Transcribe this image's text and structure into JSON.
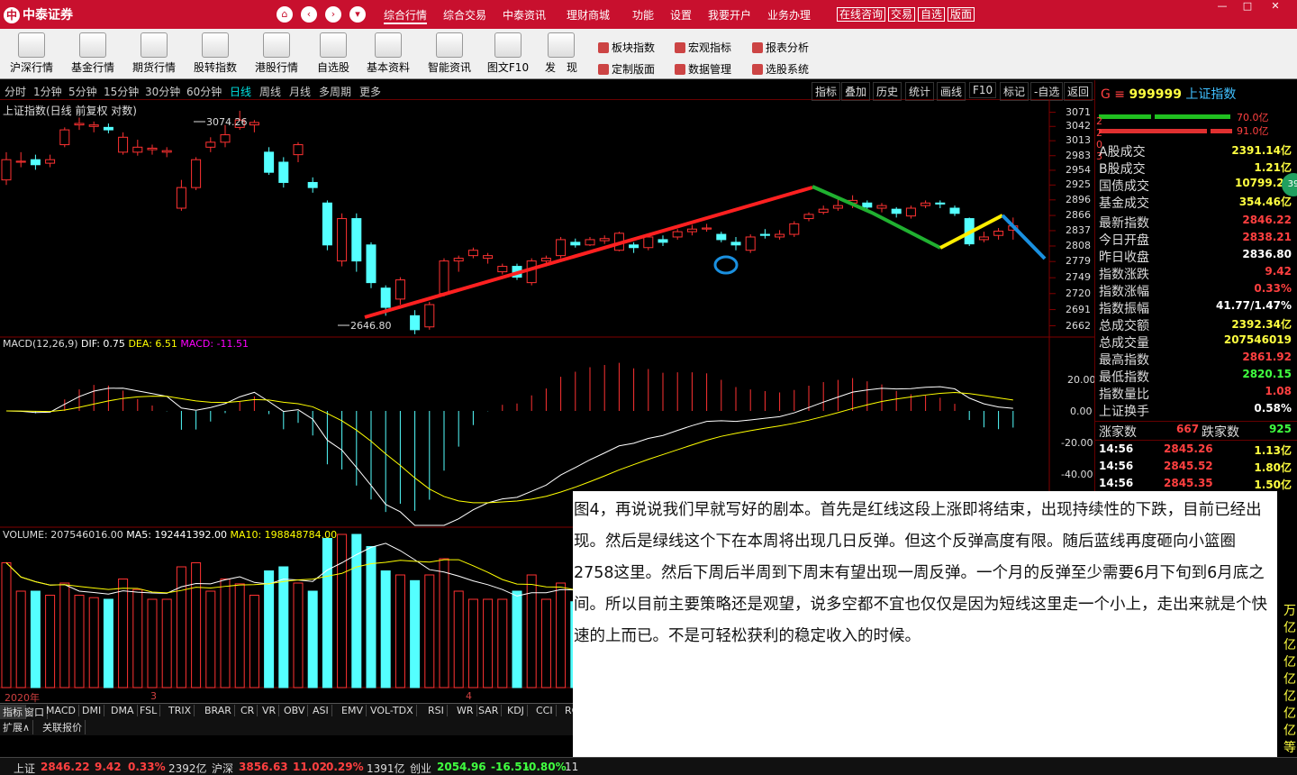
{
  "app": {
    "logo_text": "中泰证券",
    "logo_mark": "中"
  },
  "nav": {
    "home_icon": "⌂",
    "back_icon": "‹",
    "forward_icon": "›",
    "down_icon": "▾"
  },
  "menu": [
    "综合行情",
    "综合交易",
    "中泰资讯",
    "理财商城",
    "功能",
    "设置",
    "我要开户",
    "业务办理"
  ],
  "topbuttons": [
    "在线咨询",
    "交易",
    "自选",
    "版面"
  ],
  "window": {
    "min": "—",
    "max": "□",
    "close": "✕"
  },
  "toolbar": [
    "沪深行情",
    "基金行情",
    "期货行情",
    "股转指数",
    "港股行情",
    "自选股",
    "基本资料",
    "智能资讯",
    "图文F10",
    "发　现"
  ],
  "sidemenu": [
    "板块指数",
    "宏观指标",
    "报表分析",
    "定制版面",
    "数据管理",
    "选股系统"
  ],
  "timeframes": [
    "分时",
    "1分钟",
    "5分钟",
    "15分钟",
    "30分钟",
    "60分钟",
    "日线",
    "周线",
    "月线",
    "多周期",
    "更多"
  ],
  "charttools": [
    "指标",
    "叠加",
    "历史",
    "统计",
    "画线",
    "F10",
    "标记",
    "-自选",
    "返回"
  ],
  "main_chart": {
    "title": "上证指数(日线 前复权 对数)",
    "high_label": "3074.26",
    "low_label": "2646.80",
    "y_ticks": [
      "3071",
      "3042",
      "3013",
      "2983",
      "2954",
      "2925",
      "2896",
      "2866",
      "2837",
      "2808",
      "2779",
      "2749",
      "2720",
      "2691",
      "2662"
    ]
  },
  "macd": {
    "label": "MACD(12,26,9)",
    "dif": "DIF: 0.75",
    "dea": "DEA: 6.51",
    "macd": "MACD: -11.51",
    "y_ticks": [
      "20.00",
      "0.00",
      "-20.00",
      "-40.00"
    ]
  },
  "volume": {
    "label": "VOLUME: 207546016.00",
    "ma5": "MA5: 192441392.00",
    "ma10": "MA10: 198848784.00"
  },
  "x_labels": [
    "2020年",
    "3",
    "4"
  ],
  "indicator_tabs": [
    "指标",
    "窗口",
    "MACD",
    "DMI",
    "DMA",
    "FSL",
    "TRIX",
    "BRAR",
    "CR",
    "VR",
    "OBV",
    "ASI",
    "EMV",
    "VOL-TDX",
    "RSI",
    "WR",
    "SAR",
    "KDJ",
    "CCI",
    "RO"
  ],
  "extra_tabs": [
    "扩展∧",
    "关联报价"
  ],
  "right_panel": {
    "code": "999999",
    "name": "上证指数",
    "prefix": "G ≡",
    "bar_values": [
      "70.0亿",
      "91.0亿"
    ],
    "side_labels": [
      "2",
      "2",
      "0",
      "3"
    ],
    "turnover": [
      {
        "k": "A股成交",
        "v": "2391.14亿"
      },
      {
        "k": "B股成交",
        "v": "1.21亿"
      },
      {
        "k": "国债成交",
        "v": "10799.24"
      },
      {
        "k": "基金成交",
        "v": "354.46亿"
      }
    ],
    "stats": [
      {
        "k": "最新指数",
        "v": "2846.22",
        "c": "#ff4040"
      },
      {
        "k": "今日开盘",
        "v": "2838.21",
        "c": "#ff4040"
      },
      {
        "k": "昨日收盘",
        "v": "2836.80",
        "c": "#ffffff"
      },
      {
        "k": "指数涨跌",
        "v": "9.42",
        "c": "#ff4040"
      },
      {
        "k": "指数涨幅",
        "v": "0.33%",
        "c": "#ff4040"
      },
      {
        "k": "指数振幅",
        "v": "41.77/1.47%",
        "c": "#ffffff"
      },
      {
        "k": "总成交额",
        "v": "2392.34亿",
        "c": "#ffff40"
      },
      {
        "k": "总成交量",
        "v": "207546019",
        "c": "#ffff40"
      },
      {
        "k": "最高指数",
        "v": "2861.92",
        "c": "#ff4040"
      },
      {
        "k": "最低指数",
        "v": "2820.15",
        "c": "#40ff40"
      },
      {
        "k": "指数量比",
        "v": "1.08",
        "c": "#ff4040"
      },
      {
        "k": "上证换手",
        "v": "0.58%",
        "c": "#ffffff"
      }
    ],
    "updown": {
      "up_label": "涨家数",
      "up": "667",
      "down_label": "跌家数",
      "down": "925"
    },
    "ticks": [
      {
        "t": "14:56",
        "p": "2845.26",
        "v": "1.13亿"
      },
      {
        "t": "14:56",
        "p": "2845.52",
        "v": "1.80亿"
      },
      {
        "t": "14:56",
        "p": "2845.35",
        "v": "1.50亿"
      }
    ],
    "badge": "39",
    "partial_right": [
      "万",
      "亿",
      "亿",
      "亿",
      "亿",
      "亿",
      "亿",
      "亿",
      "等"
    ]
  },
  "note": "图4，再说说我们早就写好的剧本。首先是红线这段上涨即将结束，出现持续性的下跌，目前已经出现。然后是绿线这个下在本周将出现几日反弹。但这个反弹高度有限。随后蓝线再度砸向小篮圈2758这里。然后下周后半周到下周末有望出现一周反弹。一个月的反弹至少需要6月下旬到6月底之间。所以目前主要策略还是观望，说多空都不宜也仅仅是因为短线这里走一个小上，走出来就是个快速的上而已。不是可轻松获利的稳定收入的时候。",
  "status": [
    {
      "name": "上证",
      "price": "2846.22",
      "chg": "9.42",
      "pct": "0.33%",
      "amt": "2392亿"
    },
    {
      "name": "沪深",
      "price": "3856.63",
      "chg": "11.02",
      "pct": "0.29%",
      "amt": "1391亿"
    },
    {
      "name": "创业",
      "price": "2054.96",
      "chg": "-16.51",
      "pct": "-0.80%",
      "amt": "11"
    }
  ],
  "chart_data": {
    "type": "candlestick",
    "scale": "log",
    "ylim": [
      2650,
      3085
    ],
    "candles": [
      [
        2935,
        2975,
        2990,
        2925
      ],
      [
        2970,
        2972,
        2990,
        2960
      ],
      [
        2975,
        2965,
        2985,
        2955
      ],
      [
        2968,
        2975,
        2985,
        2960
      ],
      [
        3005,
        3035,
        3040,
        3000
      ],
      [
        3045,
        3048,
        3060,
        3035
      ],
      [
        3042,
        3045,
        3052,
        3030
      ],
      [
        3040,
        3035,
        3048,
        3028
      ],
      [
        2990,
        3020,
        3030,
        2985
      ],
      [
        2990,
        3000,
        3015,
        2983
      ],
      [
        2995,
        2998,
        3005,
        2985
      ],
      [
        2990,
        2993,
        3000,
        2980
      ],
      [
        2880,
        2920,
        2935,
        2875
      ],
      [
        2920,
        2975,
        2980,
        2915
      ],
      [
        3000,
        3010,
        3020,
        2990
      ],
      [
        3010,
        3025,
        3045,
        3000
      ],
      [
        3040,
        3055,
        3074,
        3035
      ],
      [
        3045,
        3050,
        3055,
        3030
      ],
      [
        2990,
        2950,
        3000,
        2945
      ],
      [
        2970,
        2930,
        2980,
        2920
      ],
      [
        2985,
        3005,
        3010,
        2970
      ],
      [
        2930,
        2920,
        2940,
        2910
      ],
      [
        2890,
        2810,
        2895,
        2800
      ],
      [
        2780,
        2860,
        2870,
        2770
      ],
      [
        2860,
        2780,
        2870,
        2760
      ],
      [
        2810,
        2740,
        2815,
        2730
      ],
      [
        2730,
        2695,
        2735,
        2680
      ],
      [
        2710,
        2745,
        2750,
        2700
      ],
      [
        2680,
        2655,
        2690,
        2647
      ],
      [
        2660,
        2700,
        2705,
        2655
      ],
      [
        2720,
        2780,
        2785,
        2715
      ],
      [
        2780,
        2785,
        2790,
        2760
      ],
      [
        2790,
        2800,
        2805,
        2785
      ],
      [
        2785,
        2790,
        2795,
        2775
      ],
      [
        2760,
        2770,
        2775,
        2755
      ],
      [
        2770,
        2750,
        2775,
        2745
      ],
      [
        2740,
        2780,
        2785,
        2735
      ],
      [
        2780,
        2785,
        2790,
        2770
      ],
      [
        2790,
        2820,
        2825,
        2785
      ],
      [
        2815,
        2810,
        2822,
        2805
      ],
      [
        2810,
        2820,
        2825,
        2808
      ],
      [
        2818,
        2822,
        2828,
        2812
      ],
      [
        2800,
        2832,
        2835,
        2798
      ],
      [
        2810,
        2805,
        2815,
        2795
      ],
      [
        2805,
        2825,
        2830,
        2800
      ],
      [
        2820,
        2815,
        2828,
        2808
      ],
      [
        2825,
        2835,
        2840,
        2820
      ],
      [
        2835,
        2840,
        2848,
        2828
      ],
      [
        2840,
        2842,
        2850,
        2835
      ],
      [
        2830,
        2820,
        2835,
        2815
      ],
      [
        2815,
        2810,
        2825,
        2800
      ],
      [
        2800,
        2825,
        2830,
        2795
      ],
      [
        2830,
        2828,
        2840,
        2822
      ],
      [
        2825,
        2830,
        2838,
        2820
      ],
      [
        2830,
        2850,
        2855,
        2825
      ],
      [
        2860,
        2868,
        2872,
        2855
      ],
      [
        2872,
        2878,
        2885,
        2868
      ],
      [
        2880,
        2885,
        2900,
        2875
      ],
      [
        2890,
        2895,
        2905,
        2880
      ],
      [
        2890,
        2882,
        2895,
        2875
      ],
      [
        2880,
        2885,
        2890,
        2872
      ],
      [
        2878,
        2870,
        2882,
        2862
      ],
      [
        2865,
        2880,
        2885,
        2860
      ],
      [
        2885,
        2890,
        2895,
        2880
      ],
      [
        2890,
        2888,
        2895,
        2880
      ],
      [
        2880,
        2870,
        2885,
        2865
      ],
      [
        2860,
        2812,
        2862,
        2808
      ],
      [
        2820,
        2825,
        2835,
        2815
      ],
      [
        2828,
        2836,
        2842,
        2820
      ],
      [
        2838,
        2846,
        2862,
        2820
      ]
    ]
  }
}
